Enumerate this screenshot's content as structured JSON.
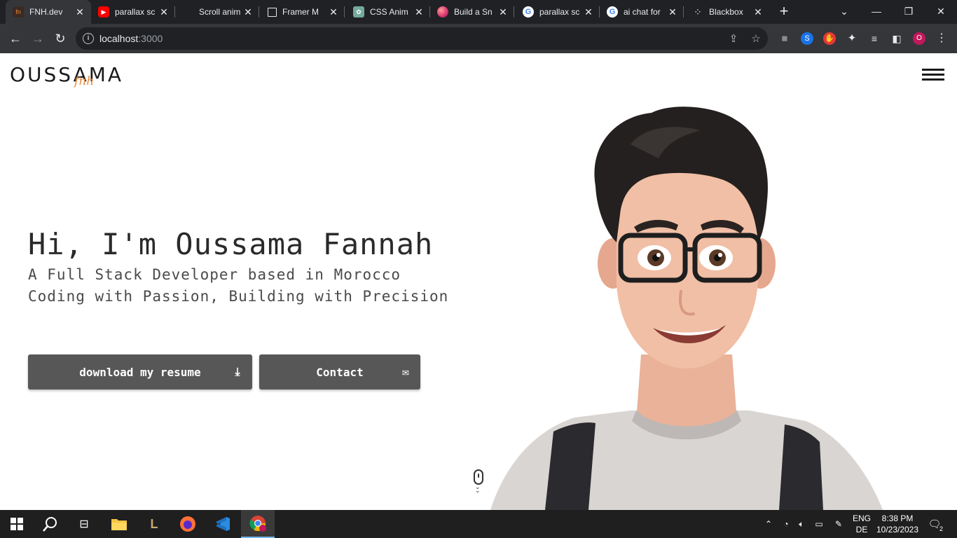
{
  "browser": {
    "tabs": [
      {
        "title": "FNH.dev",
        "icon": "fnh-favicon",
        "active": true
      },
      {
        "title": "parallax sc",
        "icon": "youtube-icon"
      },
      {
        "title": "Scroll anim",
        "icon": "blank-favicon"
      },
      {
        "title": "Framer M",
        "icon": "framer-icon"
      },
      {
        "title": "CSS Anim",
        "icon": "chatgpt-icon"
      },
      {
        "title": "Build a Sn",
        "icon": "orb-icon"
      },
      {
        "title": "parallax sc",
        "icon": "google-icon"
      },
      {
        "title": "ai chat for",
        "icon": "google-icon"
      },
      {
        "title": "Blackbox",
        "icon": "blackbox-icon"
      }
    ],
    "url_host": "localhost",
    "url_port": ":3000",
    "profile_initial": "O"
  },
  "site": {
    "logo": "OUSSAMA",
    "logo_sub": "fnh",
    "hero_title": "Hi, I'm Oussama Fannah",
    "hero_line1": "A Full Stack Developer based in Morocco",
    "hero_line2": "Coding with Passion, Building with Precision",
    "btn_resume": "download my resume",
    "btn_contact": "Contact"
  },
  "taskbar": {
    "lang_top": "ENG",
    "lang_bottom": "DE",
    "time": "8:38 PM",
    "date": "10/23/2023",
    "notification_count": "2"
  },
  "colors": {
    "tab_strip": "#202124",
    "toolbar": "#35363a",
    "button_bg": "#575757",
    "logo_accent": "#e8883a",
    "taskbar": "#1f1f1f"
  }
}
